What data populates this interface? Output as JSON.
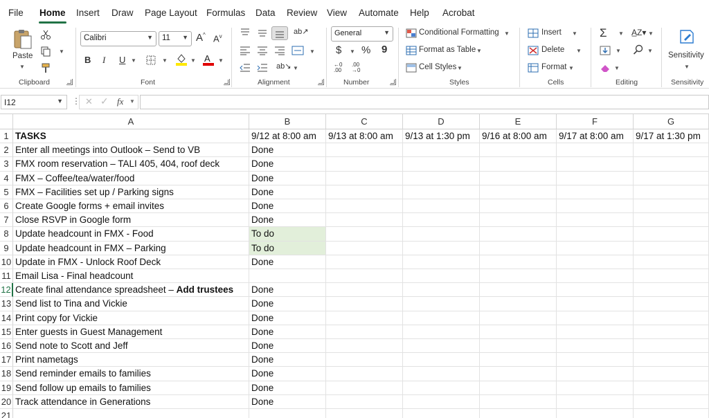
{
  "menu": {
    "tabs": [
      "File",
      "Home",
      "Insert",
      "Draw",
      "Page Layout",
      "Formulas",
      "Data",
      "Review",
      "View",
      "Automate",
      "Help",
      "Acrobat"
    ],
    "active": "Home"
  },
  "ribbon": {
    "clipboard": {
      "paste": "Paste",
      "label": "Clipboard"
    },
    "font": {
      "name": "Calibri",
      "size": "11",
      "label": "Font",
      "bold": "B",
      "italic": "I",
      "underline": "U"
    },
    "alignment": {
      "label": "Alignment"
    },
    "number": {
      "format": "General",
      "currency": "$",
      "percent": "%",
      "comma": "9",
      "label": "Number"
    },
    "styles": {
      "conditional": "Conditional Formatting",
      "table": "Format as Table",
      "cell_styles": "Cell Styles",
      "label": "Styles"
    },
    "cells": {
      "insert": "Insert",
      "delete": "Delete",
      "format": "Format",
      "label": "Cells"
    },
    "editing": {
      "label": "Editing"
    },
    "sensitivity": {
      "button": "Sensitivity",
      "label": "Sensitivity"
    },
    "colors": {
      "highlight": "#ffe800",
      "font_color": "#e00000"
    }
  },
  "formula_bar": {
    "name_box": "I12",
    "fx": "fx",
    "value": ""
  },
  "sheet": {
    "columns": [
      "A",
      "B",
      "C",
      "D",
      "E",
      "F",
      "G"
    ],
    "selected_row": "12",
    "highlight_color": "#e2efda",
    "rows": [
      {
        "n": "1",
        "a": "TASKS",
        "a_bold": true,
        "b": "9/12 at 8:00 am",
        "c": "9/13 at 8:00 am",
        "d": "9/13 at 1:30 pm",
        "e": "9/16 at 8:00 am",
        "f": "9/17 at 8:00 am",
        "g": "9/17 at 1:30 pm"
      },
      {
        "n": "2",
        "a": "Enter all meetings into Outlook – Send to VB",
        "b": "Done"
      },
      {
        "n": "3",
        "a": "FMX room reservation – TALI 405, 404, roof deck",
        "b": "Done"
      },
      {
        "n": "4",
        "a": "FMX – Coffee/tea/water/food",
        "b": "Done"
      },
      {
        "n": "5",
        "a": "FMX – Facilities set up / Parking signs",
        "b": "Done"
      },
      {
        "n": "6",
        "a": "Create Google forms + email invites",
        "b": "Done"
      },
      {
        "n": "7",
        "a": "Close RSVP in Google form",
        "b": "Done"
      },
      {
        "n": "8",
        "a": "Update headcount in FMX - Food",
        "b": "To do",
        "hl": true
      },
      {
        "n": "9",
        "a": "Update headcount in FMX – Parking",
        "b": "To do",
        "hl": true
      },
      {
        "n": "10",
        "a": "Update in FMX - Unlock Roof Deck",
        "b": "Done"
      },
      {
        "n": "11",
        "a": "Email Lisa - Final headcount",
        "b": ""
      },
      {
        "n": "12",
        "a": "Create final attendance spreadsheet – ",
        "a_bold_tail": "Add trustees",
        "b": "Done"
      },
      {
        "n": "13",
        "a": "Send list to Tina and Vickie",
        "b": "Done"
      },
      {
        "n": "14",
        "a": "Print copy for Vickie",
        "b": "Done"
      },
      {
        "n": "15",
        "a": "Enter guests in Guest Management",
        "b": "Done"
      },
      {
        "n": "16",
        "a": "Send note to Scott and Jeff",
        "b": "Done"
      },
      {
        "n": "17",
        "a": "Print nametags",
        "b": "Done"
      },
      {
        "n": "18",
        "a": "Send reminder emails to families",
        "b": "Done"
      },
      {
        "n": "19",
        "a": "Send follow up emails to families",
        "b": "Done"
      },
      {
        "n": "20",
        "a": "Track attendance in Generations",
        "b": "Done"
      },
      {
        "n": "21",
        "a": "",
        "b": ""
      }
    ]
  }
}
